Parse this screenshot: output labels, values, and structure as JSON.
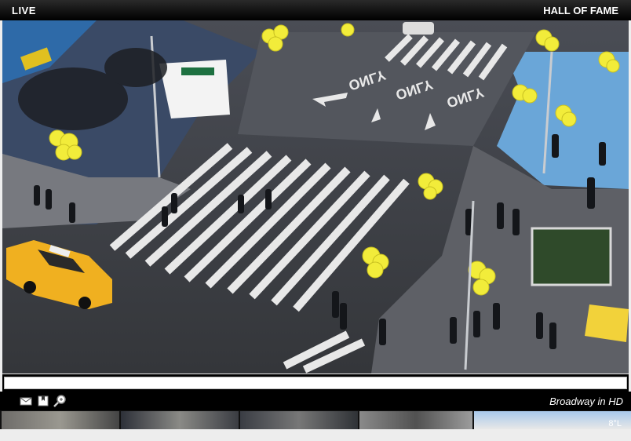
{
  "header": {
    "live_label": "LIVE",
    "title": "HALL OF FAME"
  },
  "video": {
    "street_text_1": "ONLY",
    "street_text_2": "ONLY",
    "street_text_3": "ONLY",
    "kiosk_sign": ""
  },
  "controls": {
    "caption": "Broadway in HD",
    "icons": [
      "envelope-icon",
      "bookmark-icon",
      "zoom-icon"
    ]
  },
  "thumbnails": [
    {
      "name": "thumbnail-1"
    },
    {
      "name": "thumbnail-2"
    },
    {
      "name": "thumbnail-3"
    },
    {
      "name": "thumbnail-4"
    },
    {
      "name": "thumbnail-5"
    }
  ],
  "thumbnail_overlay_text": "8°L"
}
